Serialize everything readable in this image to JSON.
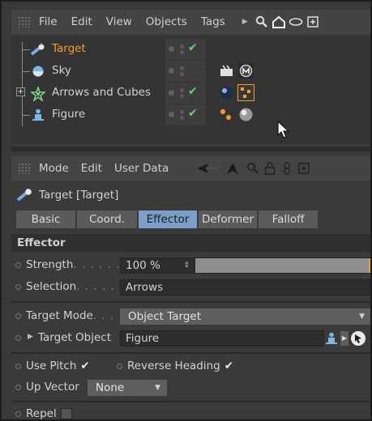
{
  "object_manager": {
    "menu": [
      "File",
      "Edit",
      "View",
      "Objects",
      "Tags"
    ],
    "toolbar_icons": [
      "arrow-right-icon",
      "search-icon",
      "home-icon",
      "eye-icon",
      "new-window-icon"
    ],
    "objects": [
      {
        "name": "Target",
        "icon": "target-icon",
        "selected": true
      },
      {
        "name": "Sky",
        "icon": "sky-icon"
      },
      {
        "name": "Arrows and Cubes",
        "icon": "cloner-icon",
        "expand": "+"
      },
      {
        "name": "Figure",
        "icon": "figure-icon"
      }
    ]
  },
  "attribute_manager": {
    "menu": [
      "Mode",
      "Edit",
      "User Data"
    ],
    "toolbar_icons": [
      "back-arrow-icon",
      "up-arrow-icon",
      "search-icon",
      "lock-icon",
      "link-icon",
      "new-window-icon"
    ],
    "object_title": "Target [Target]",
    "tabs": [
      "Basic",
      "Coord.",
      "Effector",
      "Deformer",
      "Falloff"
    ],
    "active_tab": "Effector",
    "section": "Effector",
    "strength": {
      "label": "Strength",
      "dots": ". . . . . .",
      "value": "100 %",
      "fraction": 0.99
    },
    "selection": {
      "label": "Selection",
      "dots": ". . . . . .",
      "value": "Arrows"
    },
    "target_mode": {
      "label": "Target Mode",
      "dots": ". . .",
      "value": "Object Target"
    },
    "target_object": {
      "label": "Target Object",
      "value": "Figure"
    },
    "use_pitch": {
      "label": "Use Pitch",
      "checked": true
    },
    "reverse_heading": {
      "label": "Reverse Heading",
      "checked": true
    },
    "up_vector": {
      "label": "Up Vector",
      "value": "None"
    },
    "repel": {
      "label": "Repel",
      "checked": false
    }
  },
  "colors": {
    "accent": "#f0a030",
    "active_tab": "#7c9fc9",
    "check": "#6cd06c"
  }
}
